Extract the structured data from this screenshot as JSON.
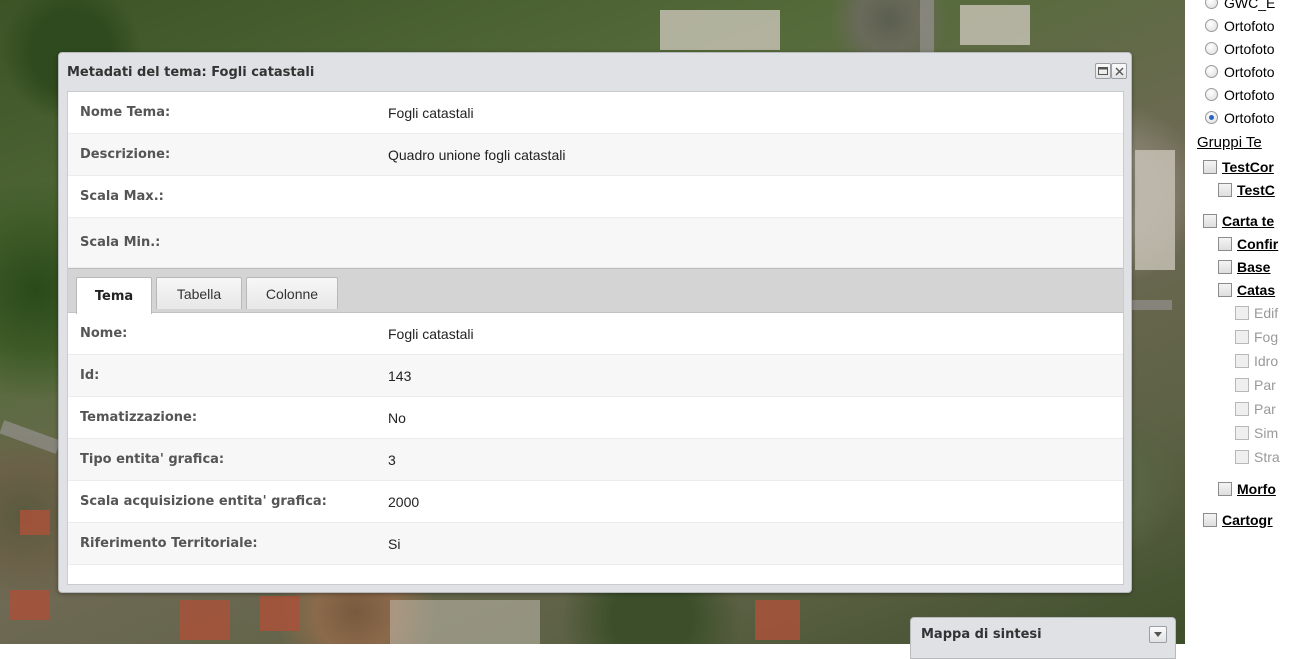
{
  "window": {
    "title": "Metadati del tema: Fogli catastali",
    "maximize_icon": "maximize-icon",
    "close_icon": "close-icon"
  },
  "summary": [
    {
      "label": "Nome Tema:",
      "value": "Fogli catastali"
    },
    {
      "label": "Descrizione:",
      "value": "Quadro unione fogli catastali"
    },
    {
      "label": "Scala Max.:",
      "value": ""
    },
    {
      "label": "Scala Min.:",
      "value": ""
    }
  ],
  "tabs": [
    {
      "label": "Tema",
      "active": true
    },
    {
      "label": "Tabella",
      "active": false
    },
    {
      "label": "Colonne",
      "active": false
    }
  ],
  "details": [
    {
      "label": "Nome:",
      "value": "Fogli catastali"
    },
    {
      "label": "Id:",
      "value": "143"
    },
    {
      "label": "Tematizzazione:",
      "value": "No"
    },
    {
      "label": "Tipo entita' grafica:",
      "value": "3"
    },
    {
      "label": "Scala acquisizione entita' grafica:",
      "value": "2000"
    },
    {
      "label": "Riferimento Territoriale:",
      "value": "Si"
    }
  ],
  "minimap": {
    "title": "Mappa di sintesi",
    "toggle_icon": "chevron-down-icon"
  },
  "layer_tree": {
    "basemaps": [
      {
        "label": "GWC_E",
        "checked": false
      },
      {
        "label": "Ortofoto",
        "checked": false
      },
      {
        "label": "Ortofoto",
        "checked": false
      },
      {
        "label": "Ortofoto",
        "checked": false
      },
      {
        "label": "Ortofoto",
        "checked": false
      },
      {
        "label": "Ortofoto",
        "checked": true
      }
    ],
    "groups_heading": "Gruppi Te",
    "items": [
      {
        "label": "TestCor",
        "level": 0,
        "style": "link"
      },
      {
        "label": "TestC",
        "level": 1,
        "style": "link"
      },
      {
        "label": "Carta te",
        "level": 0,
        "style": "link"
      },
      {
        "label": "Confir",
        "level": 1,
        "style": "link"
      },
      {
        "label": "Base",
        "level": 1,
        "style": "link"
      },
      {
        "label": "Catas",
        "level": 1,
        "style": "link"
      },
      {
        "label": "Edif",
        "level": 2,
        "style": "gray"
      },
      {
        "label": "Fog",
        "level": 2,
        "style": "gray"
      },
      {
        "label": "Idro",
        "level": 2,
        "style": "gray"
      },
      {
        "label": "Par",
        "level": 2,
        "style": "gray"
      },
      {
        "label": "Par",
        "level": 2,
        "style": "gray"
      },
      {
        "label": "Sim",
        "level": 2,
        "style": "gray"
      },
      {
        "label": "Stra",
        "level": 2,
        "style": "gray"
      },
      {
        "label": "Morfo",
        "level": 1,
        "style": "link"
      },
      {
        "label": "Cartogr",
        "level": 0,
        "style": "link"
      }
    ]
  }
}
